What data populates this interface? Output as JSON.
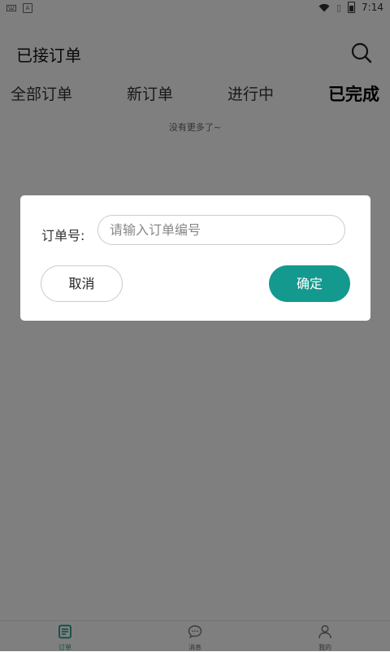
{
  "status_bar": {
    "time": "7:14",
    "left_icons": [
      "keyboard-icon",
      "a-box-icon"
    ],
    "right_icons": [
      "wifi-icon",
      "no-sim-icon",
      "battery-icon"
    ]
  },
  "header": {
    "title": "已接订单",
    "search_icon": "search-icon"
  },
  "tabs": [
    {
      "label": "全部订单",
      "active": false
    },
    {
      "label": "新订单",
      "active": false
    },
    {
      "label": "进行中",
      "active": false
    },
    {
      "label": "已完成",
      "active": true
    }
  ],
  "list": {
    "no_more_text": "没有更多了~"
  },
  "dialog": {
    "order_label": "订单号:",
    "input_placeholder": "请输入订单编号",
    "input_value": "",
    "cancel_label": "取消",
    "confirm_label": "确定"
  },
  "bottom_nav": [
    {
      "label": "订单",
      "icon": "order-list-icon",
      "active": true
    },
    {
      "label": "消息",
      "icon": "message-icon",
      "active": false
    },
    {
      "label": "我的",
      "icon": "user-icon",
      "active": false
    }
  ],
  "colors": {
    "accent": "#14998f",
    "overlay": "rgba(0,0,0,0.5)",
    "background": "#ffffff"
  }
}
